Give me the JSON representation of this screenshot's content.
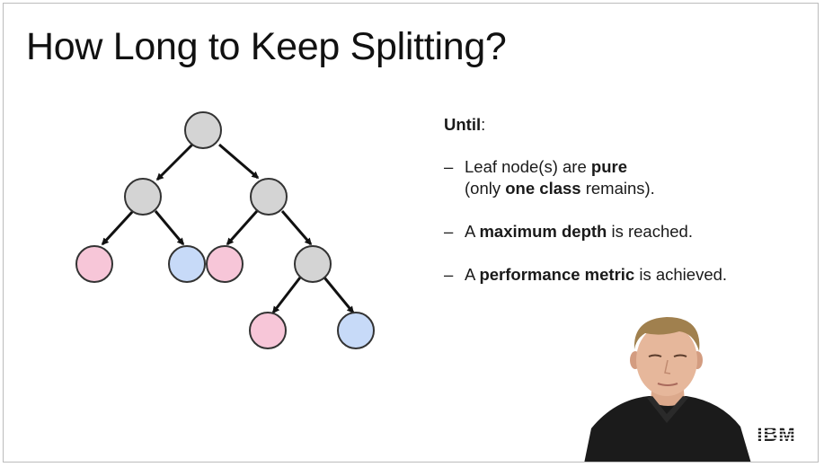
{
  "slide": {
    "title": "How Long to Keep Splitting?"
  },
  "colors": {
    "internal_node": "#d4d4d4",
    "leaf_pink": "#f7c6d8",
    "leaf_blue": "#c7daf8",
    "edge": "#111111"
  },
  "criteria": {
    "heading": "Until",
    "heading_suffix": ":",
    "items": [
      {
        "line1_a": "Leaf node(s) are ",
        "line1_b": "pure",
        "line2_a": "(only ",
        "line2_b": "one class",
        "line2_c": " remains)."
      },
      {
        "a": "A ",
        "b": "maximum depth",
        "c": " is reached."
      },
      {
        "a": "A ",
        "b": "performance metric",
        "c": " is achieved."
      }
    ],
    "bullet_symbol": "–"
  },
  "logo": {
    "text": "IBM"
  }
}
